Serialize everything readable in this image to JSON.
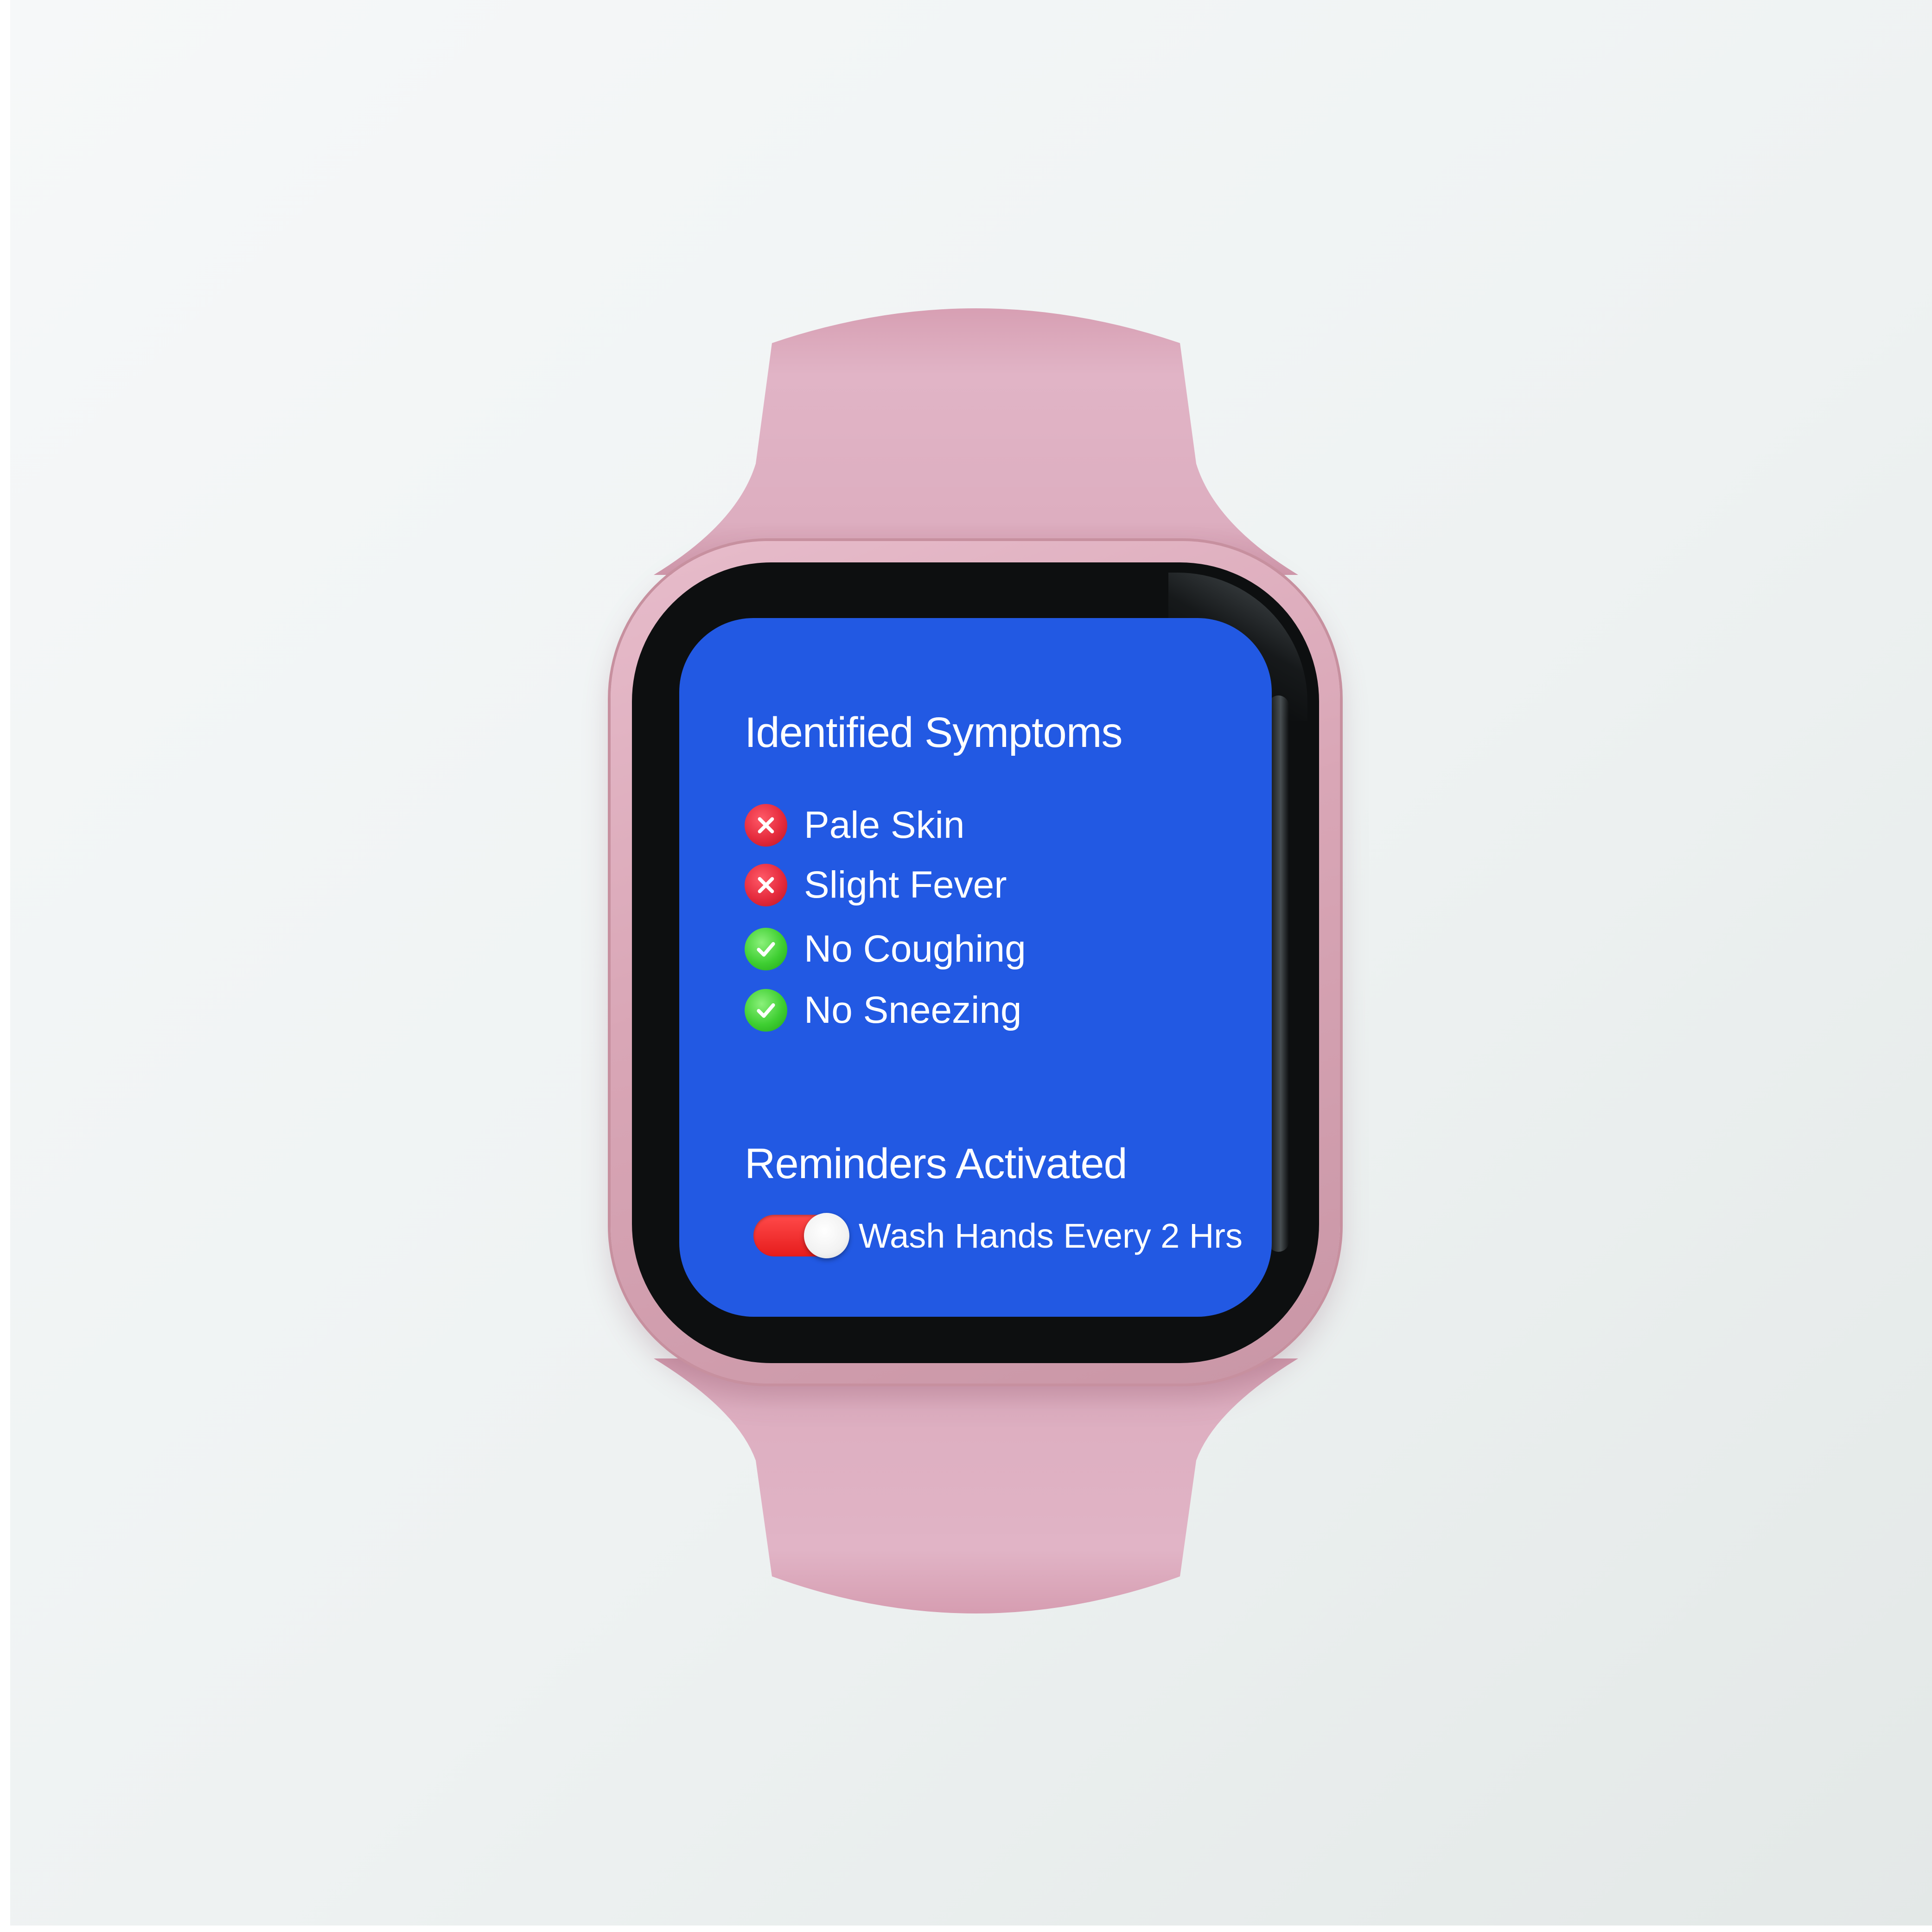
{
  "colors": {
    "screen_background": "#2259e3",
    "strap": "#dcaebf",
    "case": "#d9a6b6",
    "bezel": "#0d0f10",
    "text": "#ffffff",
    "status_bad": "#e52b3d",
    "status_good": "#3fcf32",
    "toggle_on": "#e61c1c"
  },
  "screen": {
    "symptoms_title": "Identified Symptoms",
    "symptoms": [
      {
        "label": "Pale Skin",
        "status": "bad",
        "icon": "x-circle-icon"
      },
      {
        "label": "Slight Fever",
        "status": "bad",
        "icon": "x-circle-icon"
      },
      {
        "label": "No Coughing",
        "status": "good",
        "icon": "check-circle-icon"
      },
      {
        "label": "No Sneezing",
        "status": "good",
        "icon": "check-circle-icon"
      }
    ],
    "reminders_title": "Reminders Activated",
    "reminder": {
      "label": "Wash Hands Every 2 Hrs",
      "enabled": true,
      "icon": "toggle-switch-icon"
    }
  }
}
